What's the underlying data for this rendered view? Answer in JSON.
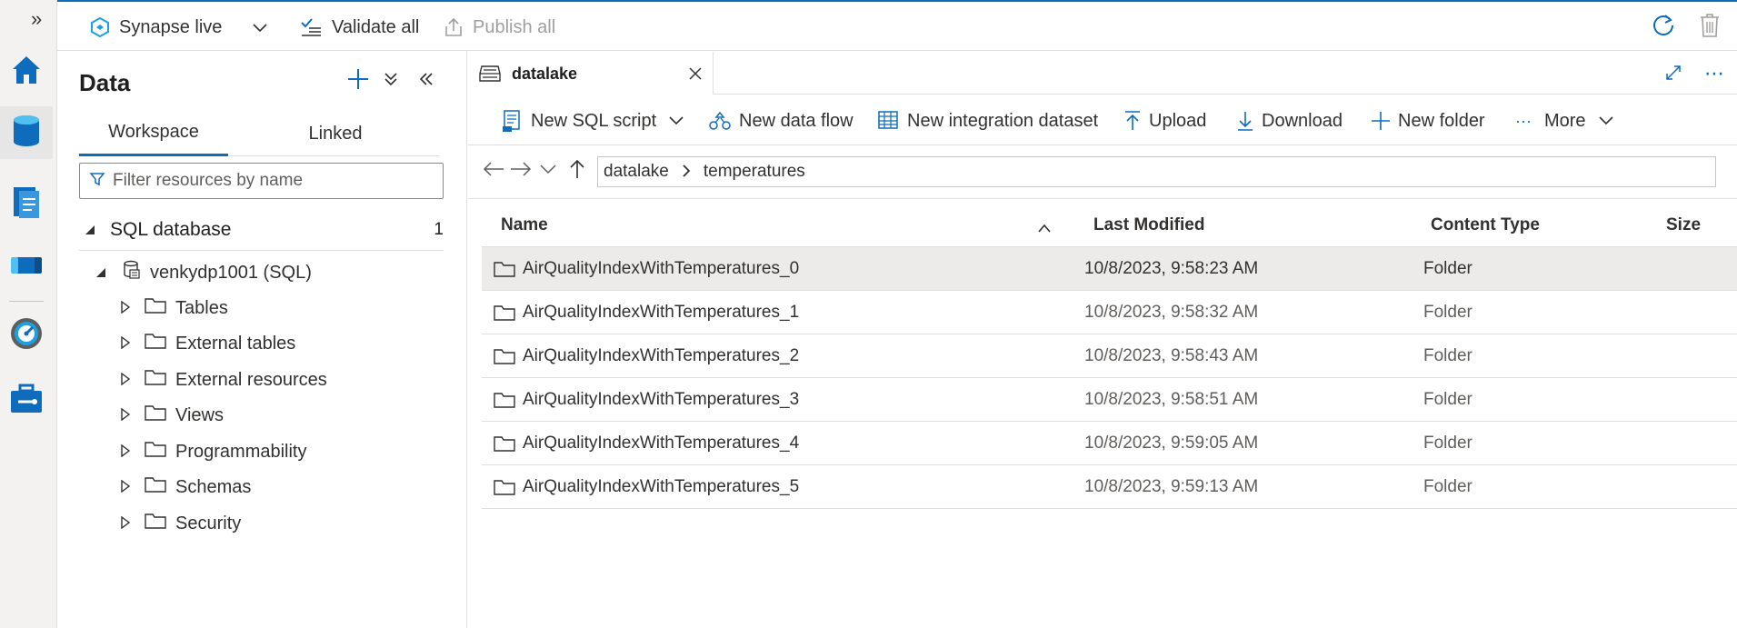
{
  "rail": {
    "expand_label": "»",
    "items": [
      {
        "name": "home-icon",
        "active": false
      },
      {
        "name": "data-icon",
        "active": true
      },
      {
        "name": "develop-icon",
        "active": false
      },
      {
        "name": "integrate-icon",
        "active": false
      },
      {
        "name": "monitor-icon",
        "active": false
      },
      {
        "name": "manage-icon",
        "active": false
      }
    ]
  },
  "topbar": {
    "synapse_live": "Synapse live",
    "validate_all": "Validate all",
    "publish_all": "Publish all"
  },
  "data_panel": {
    "title": "Data",
    "tabs": [
      {
        "label": "Workspace",
        "active": true
      },
      {
        "label": "Linked",
        "active": false
      }
    ],
    "filter_placeholder": "Filter resources by name",
    "group": {
      "label": "SQL database",
      "count": "1"
    },
    "database": {
      "label": "venkydp1001 (SQL)"
    },
    "tree_items": [
      {
        "label": "Tables"
      },
      {
        "label": "External tables"
      },
      {
        "label": "External resources"
      },
      {
        "label": "Views"
      },
      {
        "label": "Programmability"
      },
      {
        "label": "Schemas"
      },
      {
        "label": "Security"
      }
    ]
  },
  "main": {
    "doc_tab": {
      "label": "datalake"
    },
    "toolbar": {
      "new_sql_script": "New SQL script",
      "new_data_flow": "New data flow",
      "new_integration_dataset": "New integration dataset",
      "upload": "Upload",
      "download": "Download",
      "new_folder": "New folder",
      "more": "More"
    },
    "breadcrumb": [
      "datalake",
      "temperatures"
    ],
    "table": {
      "columns": [
        "Name",
        "Last Modified",
        "Content Type",
        "Size"
      ],
      "rows": [
        {
          "name": "AirQualityIndexWithTemperatures_0",
          "modified": "10/8/2023, 9:58:23 AM",
          "type": "Folder",
          "size": ""
        },
        {
          "name": "AirQualityIndexWithTemperatures_1",
          "modified": "10/8/2023, 9:58:32 AM",
          "type": "Folder",
          "size": ""
        },
        {
          "name": "AirQualityIndexWithTemperatures_2",
          "modified": "10/8/2023, 9:58:43 AM",
          "type": "Folder",
          "size": ""
        },
        {
          "name": "AirQualityIndexWithTemperatures_3",
          "modified": "10/8/2023, 9:58:51 AM",
          "type": "Folder",
          "size": ""
        },
        {
          "name": "AirQualityIndexWithTemperatures_4",
          "modified": "10/8/2023, 9:59:05 AM",
          "type": "Folder",
          "size": ""
        },
        {
          "name": "AirQualityIndexWithTemperatures_5",
          "modified": "10/8/2023, 9:59:13 AM",
          "type": "Folder",
          "size": ""
        }
      ]
    }
  },
  "colors": {
    "accent": "#0f6cbd",
    "selected_row": "#edebe9",
    "border": "#e1dfdd"
  }
}
